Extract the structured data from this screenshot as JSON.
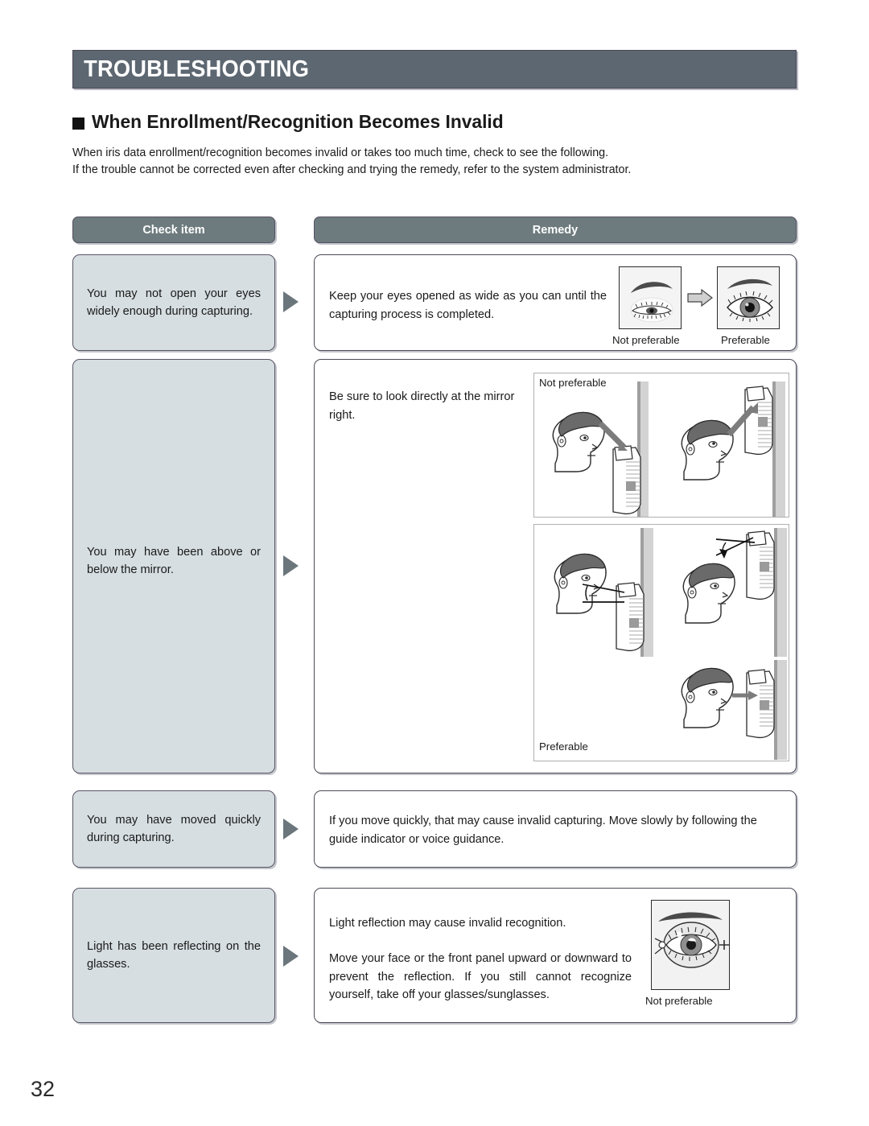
{
  "page": {
    "title": "TROUBLESHOOTING",
    "section_heading": "When Enrollment/Recognition Becomes Invalid",
    "intro_line1": "When iris data enrollment/recognition becomes invalid or takes too much time, check to see the following.",
    "intro_line2": "If the trouble cannot be corrected even after checking and trying the remedy, refer to the system administrator.",
    "page_number": "32"
  },
  "table": {
    "headers": {
      "check_item": "Check item",
      "remedy": "Remedy"
    },
    "rows": [
      {
        "check_item": "You may not open your eyes widely enough during capturing.",
        "remedy_text": "Keep your eyes opened as wide as you can until the capturing process is completed.",
        "figure_labels": [
          "Not preferable",
          "Preferable"
        ]
      },
      {
        "check_item": "You may have been above or below the mirror.",
        "remedy_text": "Be sure to look directly at the mirror right.",
        "figure_labels": [
          "Not preferable",
          "Preferable"
        ]
      },
      {
        "check_item": "You may have moved quickly during capturing.",
        "remedy_text": "If you move quickly, that may cause invalid capturing. Move slowly by following the guide indicator or voice guidance.",
        "figure_labels": []
      },
      {
        "check_item": "Light has been reflecting on the glasses.",
        "remedy_text_1": "Light reflection may cause invalid recognition.",
        "remedy_text_2": "Move your face or the front panel upward or downward to prevent the reflection. If you still cannot recognize yourself, take off your glasses/sunglasses.",
        "figure_labels": [
          "Not preferable"
        ]
      }
    ]
  },
  "colors": {
    "banner": "#5d6771",
    "header_cell": "#6e7b7e",
    "check_cell": "#d6dee1",
    "arrow": "#6b767c",
    "text": "#1a1a1a"
  }
}
